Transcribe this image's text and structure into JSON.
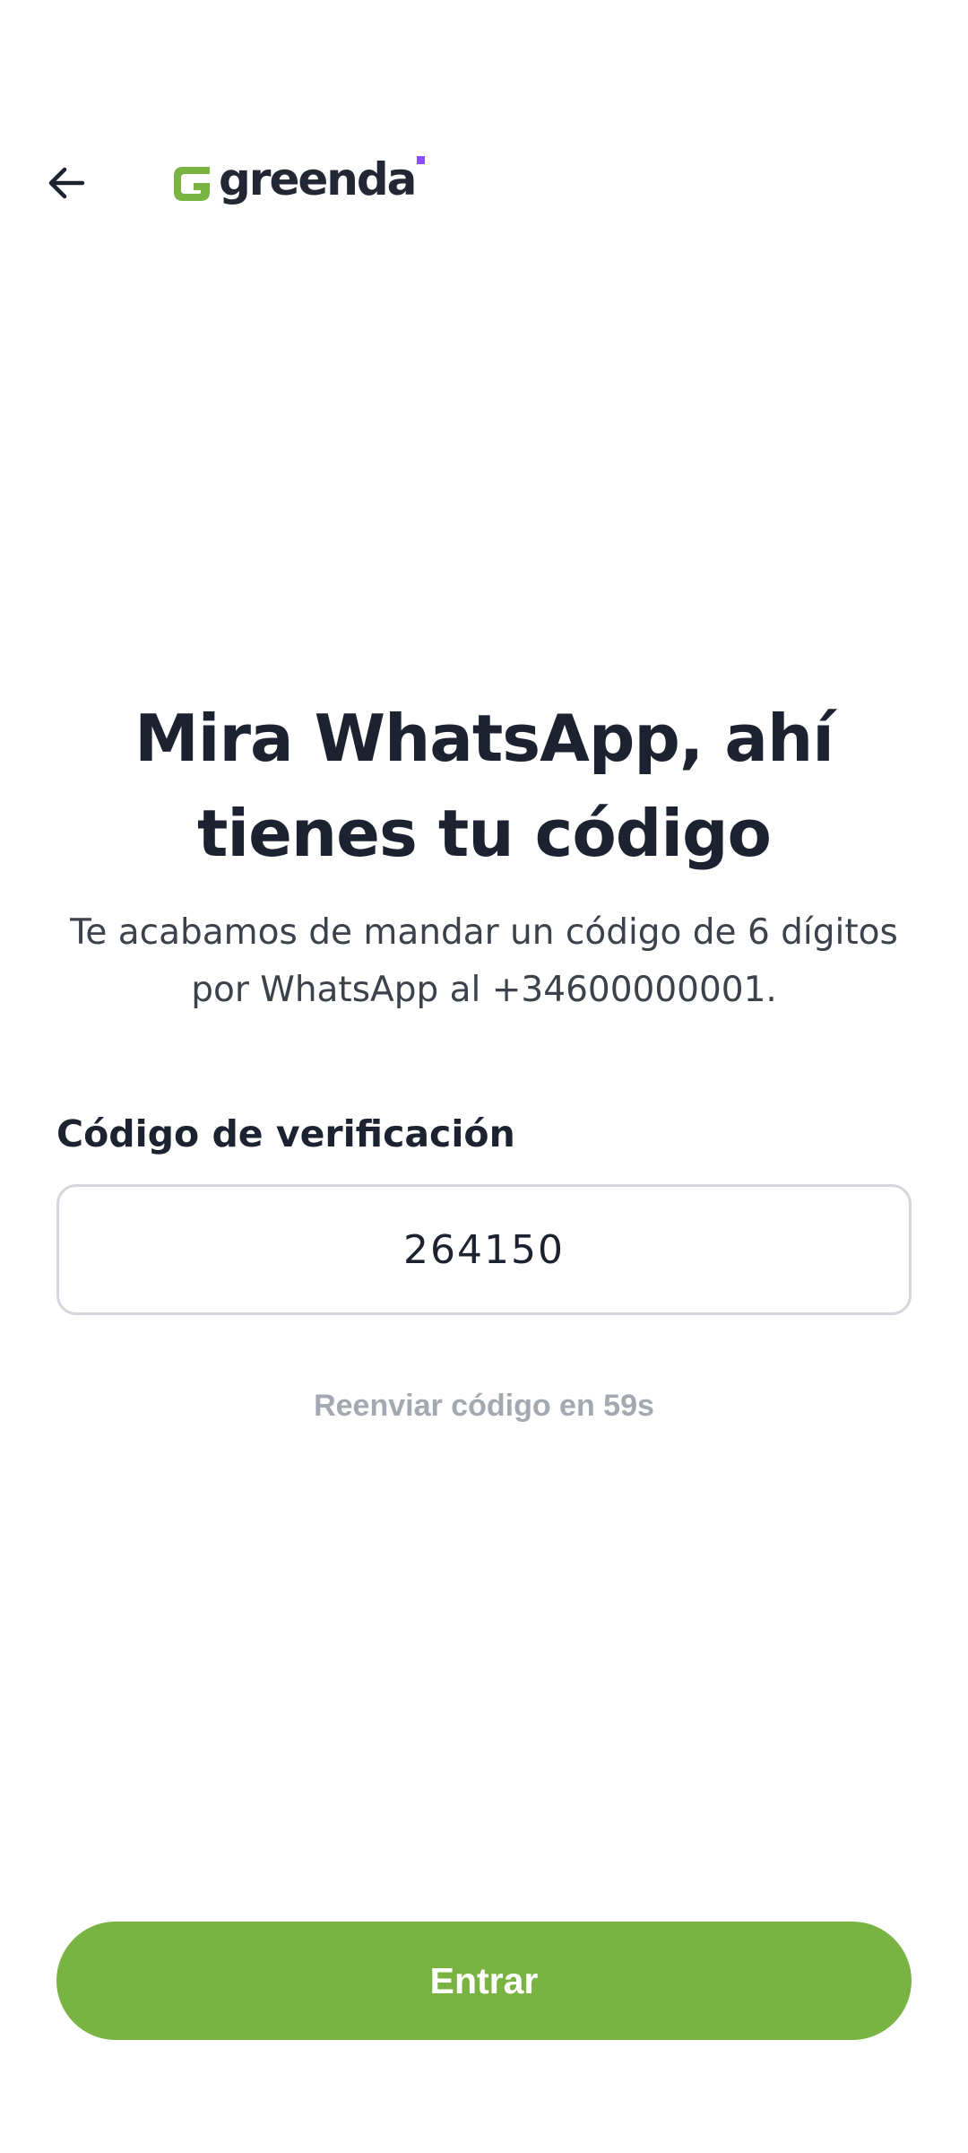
{
  "header": {
    "back_icon": "arrow-left-icon",
    "logo_text": "greenda",
    "logo_colors": {
      "mark": "#79b342",
      "text": "#232733",
      "dot": "#8b4dff"
    }
  },
  "main": {
    "title": "Mira WhatsApp, ahí tienes tu código",
    "subtitle": "Te acabamos de mandar un código de 6 dígitos por WhatsApp al +34600000001.",
    "code_field": {
      "label": "Código de verificación",
      "value": "264150"
    },
    "resend_text": "Reenviar código en 59s"
  },
  "footer": {
    "submit_label": "Entrar"
  },
  "colors": {
    "accent": "#79b342",
    "text_primary": "#1c2230",
    "text_muted": "#a4a8b1",
    "input_border": "#d3d6dc"
  }
}
